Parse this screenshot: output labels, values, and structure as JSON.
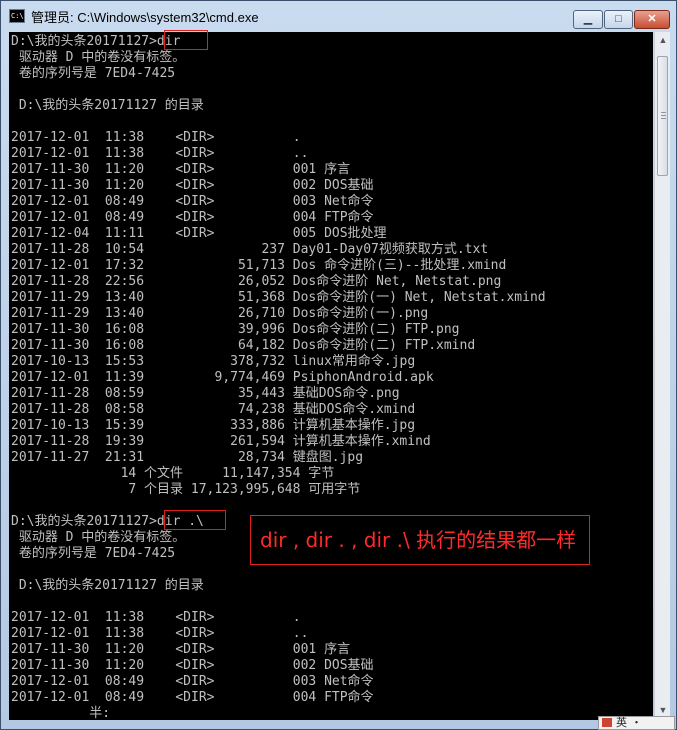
{
  "window": {
    "title": "管理员: C:\\Windows\\system32\\cmd.exe",
    "icon_text": "C:\\",
    "controls": {
      "minimize": "▁",
      "maximize": "□",
      "close": "✕"
    }
  },
  "console_lines": [
    "D:\\我的头条20171127>dir",
    " 驱动器 D 中的卷没有标签。",
    " 卷的序列号是 7ED4-7425",
    "",
    " D:\\我的头条20171127 的目录",
    "",
    "2017-12-01  11:38    <DIR>          .",
    "2017-12-01  11:38    <DIR>          ..",
    "2017-11-30  11:20    <DIR>          001 序言",
    "2017-11-30  11:20    <DIR>          002 DOS基础",
    "2017-12-01  08:49    <DIR>          003 Net命令",
    "2017-12-01  08:49    <DIR>          004 FTP命令",
    "2017-12-04  11:11    <DIR>          005 DOS批处理",
    "2017-11-28  10:54               237 Day01-Day07视频获取方式.txt",
    "2017-12-01  17:32            51,713 Dos 命令进阶(三)--批处理.xmind",
    "2017-11-28  22:56            26,052 Dos命令进阶 Net, Netstat.png",
    "2017-11-29  13:40            51,368 Dos命令进阶(一) Net, Netstat.xmind",
    "2017-11-29  13:40            26,710 Dos命令进阶(一).png",
    "2017-11-30  16:08            39,996 Dos命令进阶(二) FTP.png",
    "2017-11-30  16:08            64,182 Dos命令进阶(二) FTP.xmind",
    "2017-10-13  15:53           378,732 linux常用命令.jpg",
    "2017-12-01  11:39         9,774,469 PsiphonAndroid.apk",
    "2017-11-28  08:59            35,443 基础DOS命令.png",
    "2017-11-28  08:58            74,238 基础DOS命令.xmind",
    "2017-10-13  15:39           333,886 计算机基本操作.jpg",
    "2017-11-28  19:39           261,594 计算机基本操作.xmind",
    "2017-11-27  21:31            28,734 键盘图.jpg",
    "              14 个文件     11,147,354 字节",
    "               7 个目录 17,123,995,648 可用字节",
    "",
    "D:\\我的头条20171127>dir .\\",
    " 驱动器 D 中的卷没有标签。",
    " 卷的序列号是 7ED4-7425",
    "",
    " D:\\我的头条20171127 的目录",
    "",
    "2017-12-01  11:38    <DIR>          .",
    "2017-12-01  11:38    <DIR>          ..",
    "2017-11-30  11:20    <DIR>          001 序言",
    "2017-11-30  11:20    <DIR>          002 DOS基础",
    "2017-12-01  08:49    <DIR>          003 Net命令",
    "2017-12-01  08:49    <DIR>          004 FTP命令",
    "          半:"
  ],
  "annotation": "dir , dir . , dir .\\ 执行的结果都一样",
  "ime": {
    "mode": "英",
    "extra": "・"
  },
  "colors": {
    "console_bg": "#000000",
    "console_text": "#c0c0c0",
    "highlight": "#e02020"
  }
}
